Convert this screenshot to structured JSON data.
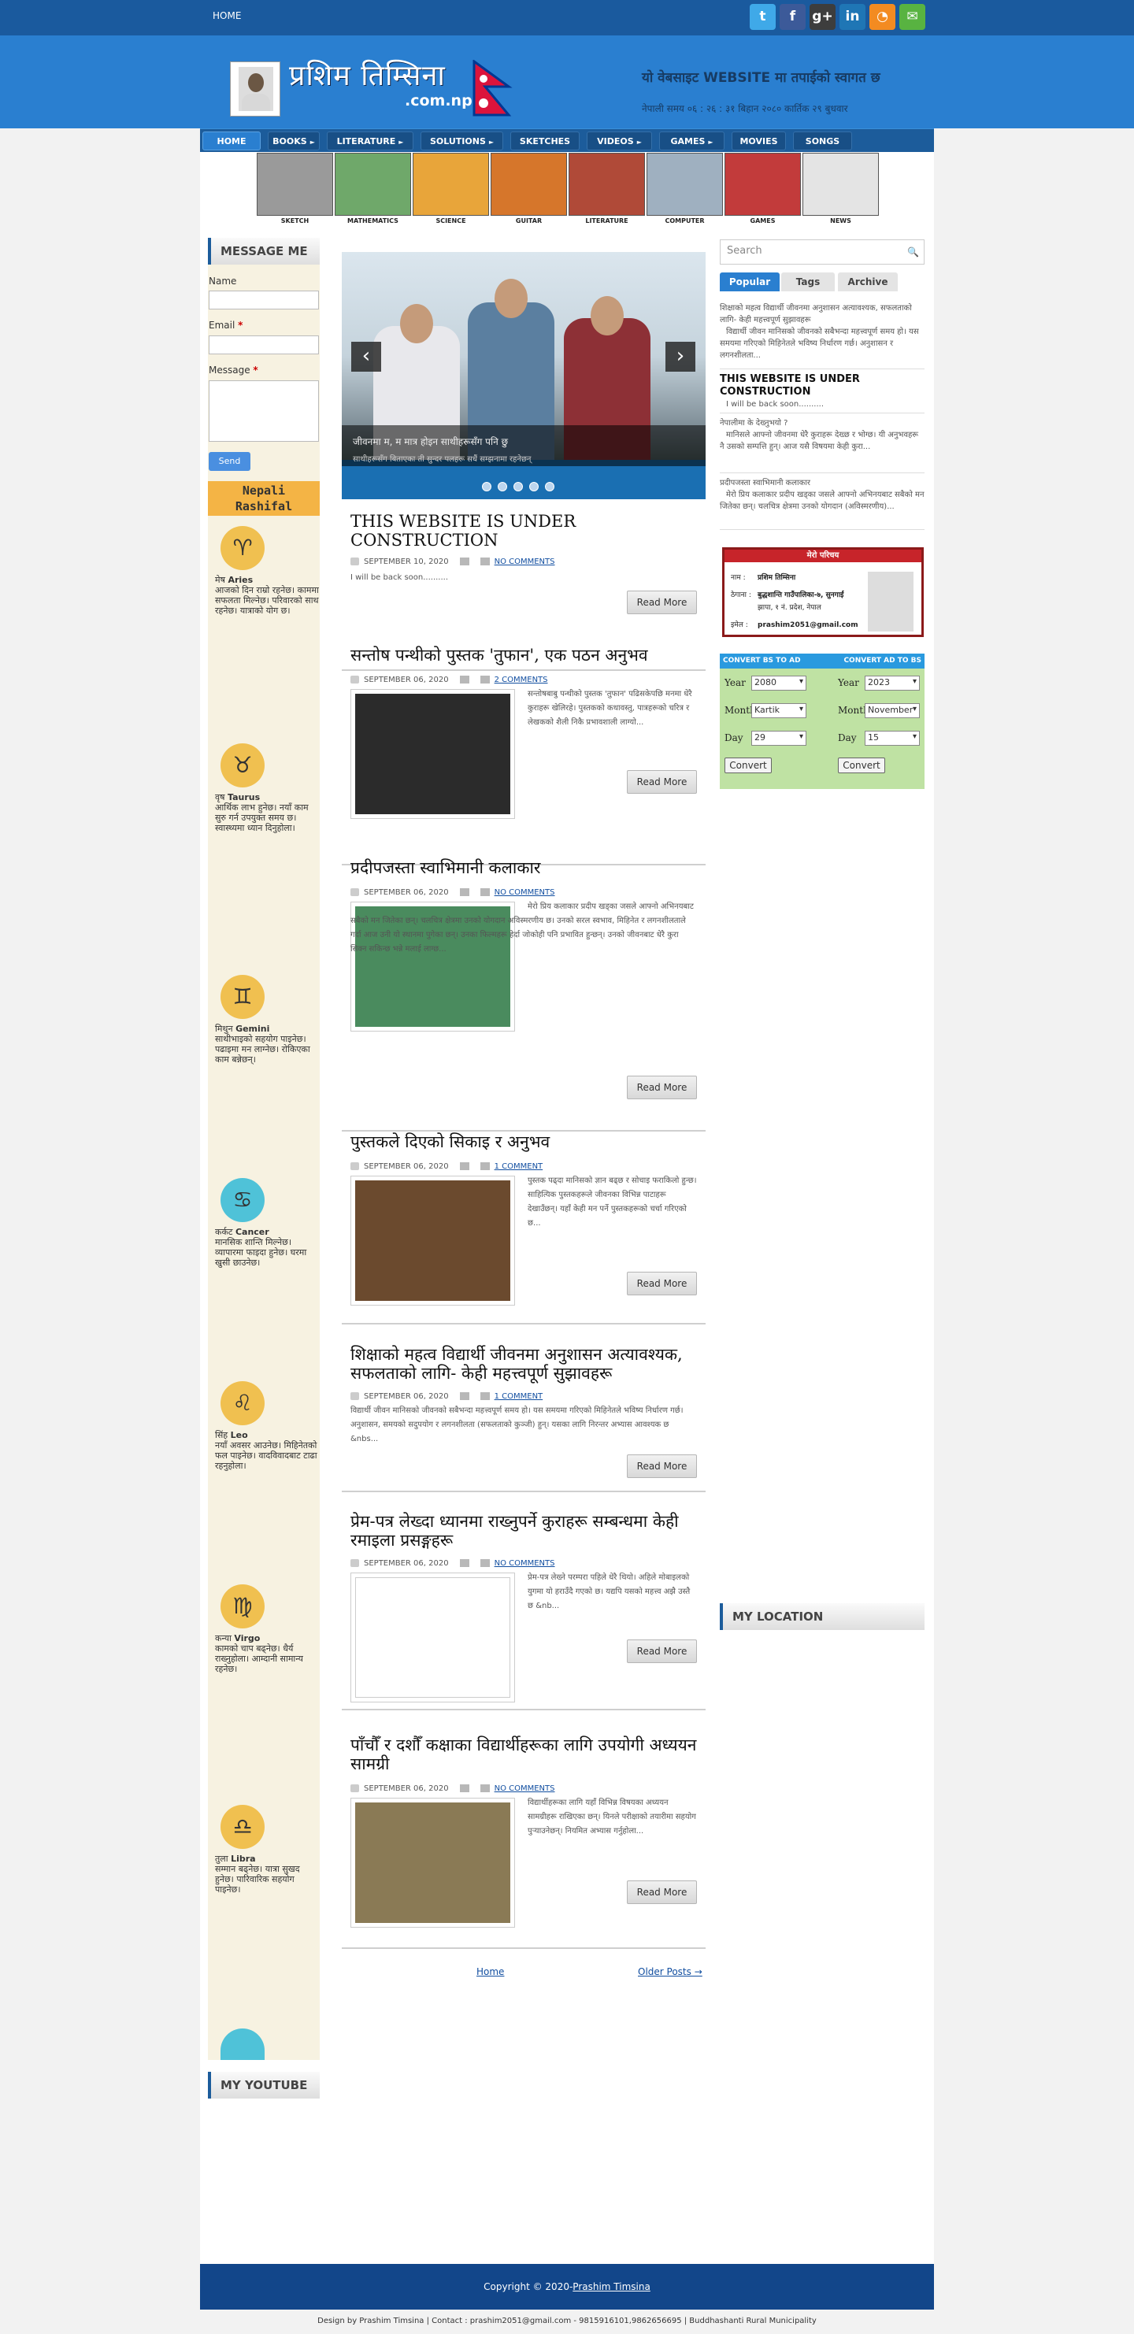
{
  "topbar": {
    "home": "HOME"
  },
  "social": [
    {
      "icon": "twitter-icon",
      "glyph": "t",
      "color": "#3fa9e8"
    },
    {
      "icon": "facebook-icon",
      "glyph": "f",
      "color": "#3c5a99"
    },
    {
      "icon": "google-plus-icon",
      "glyph": "g+",
      "color": "#3d3d3d"
    },
    {
      "icon": "linkedin-icon",
      "glyph": "in",
      "color": "#1f76b5"
    },
    {
      "icon": "rss-icon",
      "glyph": "◔",
      "color": "#f38b21"
    },
    {
      "icon": "email-icon",
      "glyph": "✉",
      "color": "#58b341"
    }
  ],
  "header": {
    "logo_text": "प्रशिम तिम्सिना",
    "logo_sub": ".com.np",
    "tagline": "यो वेबसाइट WEBSITE मा तपाईको स्वागत छ",
    "datetime": "नेपाली समय ०६ : २६ : ३१ बिहान   २०८० कार्तिक २९ बुधवार"
  },
  "nav": [
    {
      "label": "HOME",
      "caret": false,
      "active": true
    },
    {
      "label": "BOOKS",
      "caret": true
    },
    {
      "label": "LITERATURE",
      "caret": true
    },
    {
      "label": "SOLUTIONS",
      "caret": true
    },
    {
      "label": "SKETCHES",
      "caret": false
    },
    {
      "label": "VIDEOS",
      "caret": true
    },
    {
      "label": "GAMES",
      "caret": true
    },
    {
      "label": "MOVIES",
      "caret": false
    },
    {
      "label": "SONGS",
      "caret": false
    }
  ],
  "categories": [
    {
      "label": "SKETCH",
      "color": "#9a9a9a"
    },
    {
      "label": "MATHEMATICS",
      "color": "#6fa86a"
    },
    {
      "label": "SCIENCE",
      "color": "#e8a53a"
    },
    {
      "label": "GUITAR",
      "color": "#d6762b"
    },
    {
      "label": "LITERATURE",
      "color": "#b04a38"
    },
    {
      "label": "COMPUTER",
      "color": "#9fb0c0"
    },
    {
      "label": "GAMES",
      "color": "#c23b3b"
    },
    {
      "label": "NEWS",
      "color": "#e4e4e4"
    }
  ],
  "message": {
    "title": "MESSAGE ME",
    "name": "Name",
    "email": "Email",
    "message": "Message",
    "required": "*",
    "send": "Send"
  },
  "rashifal": {
    "title": "Nepali",
    "sub": "Rashifal"
  },
  "zodiac": [
    {
      "name": "Aries",
      "prefix": "मेष",
      "glyph": "♈",
      "color": "#f0c050",
      "text": "आजको दिन राम्रो रहनेछ। काममा सफलता मिल्नेछ। परिवारको साथ रहनेछ। यात्राको योग छ।"
    },
    {
      "name": "Taurus",
      "prefix": "वृष",
      "glyph": "♉",
      "color": "#f0c050",
      "text": "आर्थिक लाभ हुनेछ। नयाँ काम सुरु गर्न उपयुक्त समय छ। स्वास्थ्यमा ध्यान दिनुहोला।"
    },
    {
      "name": "Gemini",
      "prefix": "मिथुन",
      "glyph": "♊",
      "color": "#f0c050",
      "text": "साथीभाइको सहयोग पाइनेछ। पढाइमा मन लाग्नेछ। रोकिएका काम बन्नेछन्।"
    },
    {
      "name": "Cancer",
      "prefix": "कर्कट",
      "glyph": "♋",
      "color": "#4fc2d8",
      "text": "मानसिक शान्ति मिल्नेछ। व्यापारमा फाइदा हुनेछ। घरमा खुसी छाउनेछ।"
    },
    {
      "name": "Leo",
      "prefix": "सिंह",
      "glyph": "♌",
      "color": "#f0c050",
      "text": "नयाँ अवसर आउनेछ। मिहिनेतको फल पाइनेछ। वादविवादबाट टाढा रहनुहोला।"
    },
    {
      "name": "Virgo",
      "prefix": "कन्या",
      "glyph": "♍",
      "color": "#f0c050",
      "text": "कामको चाप बढ्नेछ। धैर्य राख्नुहोला। आम्दानी सामान्य रहनेछ।"
    },
    {
      "name": "Libra",
      "prefix": "तुला",
      "glyph": "♎",
      "color": "#f0c050",
      "text": "सम्मान बढ्नेछ। यात्रा सुखद हुनेछ। पारिवारिक सहयोग पाइनेछ।"
    }
  ],
  "youtube": {
    "title": "MY YOUTUBE"
  },
  "slider": {
    "caption": "जीवनमा म, म मात्र होइन साथीहरूसँग पनि छु",
    "sub": "साथीहरूसँग बिताएका ती सुन्दर पलहरू सधैं सम्झनामा रहनेछन्",
    "prev": "‹",
    "next": "›",
    "dots": 5
  },
  "posts": [
    {
      "title": "THIS WEBSITE IS UNDER CONSTRUCTION",
      "date": "SEPTEMBER 10, 2020",
      "comments": "NO COMMENTS",
      "excerpt": "I will be back soon..........",
      "readmore": "Read More",
      "has_thumb": false
    },
    {
      "title": "सन्तोष पन्थीको पुस्तक 'तुफान', एक पठन अनुभव",
      "date": "SEPTEMBER 06, 2020",
      "comments": "2 COMMENTS",
      "excerpt": "सन्तोषबाबु पन्थीको पुस्तक 'तुफान' पढिसकेपछि मनमा धेरै कुराहरू खेलिरहे। पुस्तकको कथावस्तु, पात्रहरूको चरित्र र लेखकको शैली निकै प्रभावशाली लाग्यो...",
      "readmore": "Read More",
      "has_thumb": true,
      "thumb": "#2b2b2b"
    },
    {
      "title": "प्रदीपजस्ता स्वाभिमानी कलाकार",
      "date": "SEPTEMBER 06, 2020",
      "comments": "NO COMMENTS",
      "excerpt": "मेरो प्रिय कलाकार प्रदीप खड्का जसले आफ्नो अभिनयबाट सबैको मन जितेका छन्। चलचित्र क्षेत्रमा उनको योगदान अविस्मरणीय छ। उनको सरल स्वभाव, मिहिनेत र लगनशीलताले गर्दा आज उनी यो स्थानमा पुगेका छन्। उनका फिल्महरू हेर्दा जोकोही पनि प्रभावित हुन्छन्। उनको जीवनबाट धेरै कुरा सिक्न सकिन्छ भन्ने मलाई लाग्छ...",
      "readmore": "Read More",
      "has_thumb": true,
      "thumb": "#4a8b5e"
    },
    {
      "title": "पुस्तकले दिएको सिकाइ र अनुभव",
      "date": "SEPTEMBER 06, 2020",
      "comments": "1 COMMENT",
      "excerpt": "पुस्तक पढ्दा मानिसको ज्ञान बढ्छ र सोचाइ फराकिलो हुन्छ। साहित्यिक पुस्तकहरूले जीवनका विभिन्न पाटाहरू देखाउँछन्। यहाँ केही मन पर्ने पुस्तकहरूको चर्चा गरिएको छ...",
      "readmore": "Read More",
      "has_thumb": true,
      "thumb": "#6b4a2e"
    },
    {
      "title": "शिक्षाको महत्व विद्यार्थी जीवनमा अनुशासन अत्यावश्यक, सफलताको लागि- केही महत्त्वपूर्ण सुझावहरू",
      "date": "SEPTEMBER 06, 2020",
      "comments": "1 COMMENT",
      "excerpt": "विद्यार्थी जीवन मानिसको जीवनको सबैभन्दा महत्त्वपूर्ण समय हो। यस समयमा गरिएको मिहिनेतले भविष्य निर्धारण गर्छ। अनुशासन, समयको सदुपयोग र लगनशीलता (सफलताको कुञ्जी) हुन्। यसका लागि निरन्तर अभ्यास आवश्यक छ &nbs...",
      "readmore": "Read More",
      "has_thumb": false
    },
    {
      "title": "प्रेम-पत्र लेख्दा ध्यानमा राख्नुपर्ने कुराहरू सम्बन्धमा केही रमाइला प्रसङ्गहरू",
      "date": "SEPTEMBER 06, 2020",
      "comments": "NO COMMENTS",
      "excerpt": "प्रेम-पत्र लेख्ने परम्परा पहिले धेरै थियो। अहिले मोबाइलको युगमा यो हराउँदै गएको छ। यद्यपि यसको महत्त्व अझै उस्तै छ &nb...",
      "readmore": "Read More",
      "has_thumb": true,
      "thumb": "#ffffff"
    },
    {
      "title": "पाँचौँ र दशौँ कक्षाका विद्यार्थीहरूका लागि उपयोगी अध्ययन सामग्री",
      "date": "SEPTEMBER 06, 2020",
      "comments": "NO COMMENTS",
      "excerpt": "विद्यार्थीहरूका लागि यहाँ विभिन्न विषयका अध्ययन सामग्रीहरू राखिएका छन्। यिनले परीक्षाको तयारीमा सहयोग पुर्‍याउनेछन्। नियमित अभ्यास गर्नुहोला...",
      "readmore": "Read More",
      "has_thumb": true,
      "thumb": "#8a7a55"
    }
  ],
  "pager": {
    "home": "Home",
    "older": "Older Posts →"
  },
  "sidebar": {
    "search_placeholder": "Search",
    "tabs": [
      "Popular",
      "Tags",
      "Archive"
    ],
    "popular": [
      {
        "title": "",
        "text": "शिक्षाको महत्व विद्यार्थी जीवनमा अनुशासन अत्यावश्यक, सफलताको लागि- केही महत्त्वपूर्ण सुझावहरू",
        "excerpt": "विद्यार्थी जीवन मानिसको जीवनको सबैभन्दा महत्त्वपूर्ण समय हो। यस समयमा गरिएको मिहिनेतले भविष्य निर्धारण गर्छ। अनुशासन र लगनशीलता..."
      },
      {
        "title": "THIS WEBSITE IS UNDER CONSTRUCTION",
        "text": "",
        "excerpt": "I will be back soon.........."
      },
      {
        "title": "",
        "text": "नेपालीमा के देख्नुभयो ?",
        "excerpt": "मानिसले आफ्नो जीवनमा धेरै कुराहरू देख्छ र भोग्छ। यी अनुभवहरू नै उसको सम्पत्ति हुन्। आज यसै विषयमा केही कुरा..."
      },
      {
        "title": "",
        "text": "प्रदीपजस्ता स्वाभिमानी कलाकार",
        "excerpt": "मेरो प्रिय कलाकार प्रदीप खड्का जसले आफ्नो अभिनयबाट सबैको मन जितेका छन्। चलचित्र क्षेत्रमा उनको योगदान (अविस्मरणीय)..."
      }
    ],
    "card": {
      "title": "मेरो परिचय",
      "name_label": "नाम :",
      "name": "प्रशिम तिम्सिना",
      "addr_label": "ठेगाना :",
      "addr": "बुद्धशान्ति गाउँपालिका-७, सुनगाईं",
      "addr2": "झापा, १ नं. प्रदेश, नेपाल",
      "email_label": "इमेल :",
      "email": "prashim2051@gmail.com"
    },
    "converter": {
      "left_title": "CONVERT BS TO AD",
      "right_title": "CONVERT AD TO BS",
      "year": "Year",
      "month": "Month",
      "day": "Day",
      "bs_year": "2080",
      "bs_month": "Kartik",
      "bs_day": "29",
      "ad_year": "2023",
      "ad_month": "November",
      "ad_day": "15",
      "convert": "Convert"
    },
    "location_title": "MY LOCATION"
  },
  "footer": {
    "copyright": "Copyright © 2020-",
    "owner": "Prashim Timsina",
    "credit": "Design by Prashim Timsina | Contact : prashim2051@gmail.com - 9815916101,9862656695 | Buddhashanti Rural Municipality"
  }
}
